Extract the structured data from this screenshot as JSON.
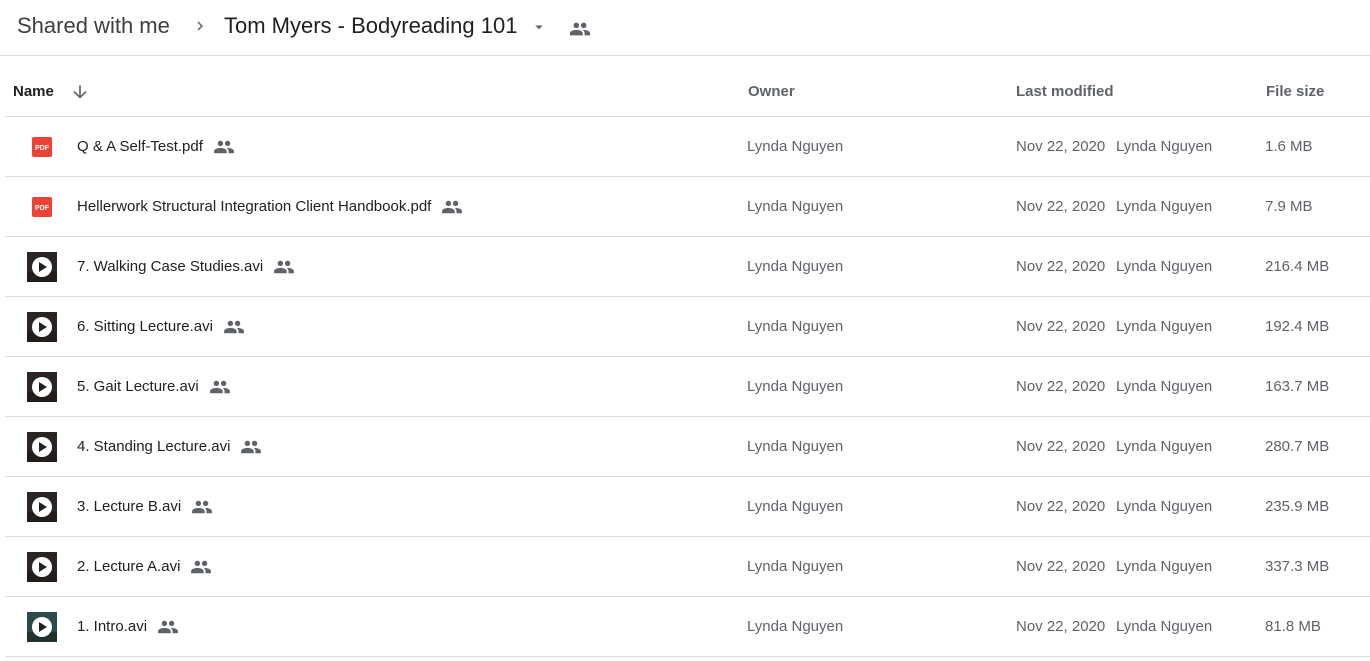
{
  "breadcrumb": {
    "root": "Shared with me",
    "current": "Tom Myers - Bodyreading 101"
  },
  "columns": {
    "name": "Name",
    "owner": "Owner",
    "last_modified": "Last modified",
    "file_size": "File size"
  },
  "colors": {
    "pdf": "#ea4335",
    "icon_gray": "#5f6368",
    "divider": "#dadce0"
  },
  "files": [
    {
      "name": "Q & A Self-Test.pdf",
      "type": "pdf",
      "owner": "Lynda Nguyen",
      "modified_date": "Nov 22, 2020",
      "modified_by": "Lynda Nguyen",
      "size": "1.6 MB",
      "icon": "pdf-icon"
    },
    {
      "name": "Hellerwork Structural Integration Client Handbook.pdf",
      "type": "pdf",
      "owner": "Lynda Nguyen",
      "modified_date": "Nov 22, 2020",
      "modified_by": "Lynda Nguyen",
      "size": "7.9 MB",
      "icon": "pdf-icon"
    },
    {
      "name": "7. Walking Case Studies.avi",
      "type": "video",
      "owner": "Lynda Nguyen",
      "modified_date": "Nov 22, 2020",
      "modified_by": "Lynda Nguyen",
      "size": "216.4 MB",
      "icon": "video-thumbnail-icon"
    },
    {
      "name": "6. Sitting Lecture.avi",
      "type": "video",
      "owner": "Lynda Nguyen",
      "modified_date": "Nov 22, 2020",
      "modified_by": "Lynda Nguyen",
      "size": "192.4 MB",
      "icon": "video-thumbnail-icon"
    },
    {
      "name": "5. Gait Lecture.avi",
      "type": "video",
      "owner": "Lynda Nguyen",
      "modified_date": "Nov 22, 2020",
      "modified_by": "Lynda Nguyen",
      "size": "163.7 MB",
      "icon": "video-thumbnail-icon"
    },
    {
      "name": "4. Standing Lecture.avi",
      "type": "video",
      "owner": "Lynda Nguyen",
      "modified_date": "Nov 22, 2020",
      "modified_by": "Lynda Nguyen",
      "size": "280.7 MB",
      "icon": "video-thumbnail-icon"
    },
    {
      "name": "3. Lecture B.avi",
      "type": "video",
      "owner": "Lynda Nguyen",
      "modified_date": "Nov 22, 2020",
      "modified_by": "Lynda Nguyen",
      "size": "235.9 MB",
      "icon": "video-thumbnail-icon"
    },
    {
      "name": "2. Lecture A.avi",
      "type": "video",
      "owner": "Lynda Nguyen",
      "modified_date": "Nov 22, 2020",
      "modified_by": "Lynda Nguyen",
      "size": "337.3 MB",
      "icon": "video-thumbnail-icon"
    },
    {
      "name": "1. Intro.avi",
      "type": "video",
      "owner": "Lynda Nguyen",
      "modified_date": "Nov 22, 2020",
      "modified_by": "Lynda Nguyen",
      "size": "81.8 MB",
      "icon": "video-thumbnail-icon"
    }
  ]
}
